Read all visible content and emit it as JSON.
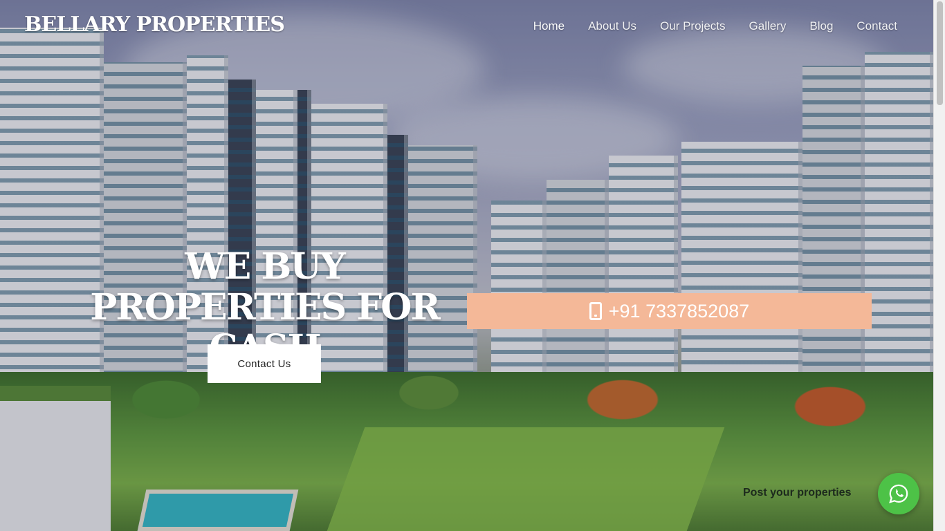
{
  "header": {
    "brand": "BELLARY PROPERTIES",
    "nav": [
      {
        "label": "Home",
        "active": true
      },
      {
        "label": "About Us",
        "active": false
      },
      {
        "label": "Our Projects",
        "active": false
      },
      {
        "label": "Gallery",
        "active": false
      },
      {
        "label": "Blog",
        "active": false
      },
      {
        "label": "Contact",
        "active": false
      }
    ]
  },
  "hero": {
    "headline": "WE BUY PROPERTIES FOR CASH",
    "cta_label": "Contact Us",
    "phone_icon": "mobile-phone-icon",
    "phone": "+91 7337852087",
    "phone_bar_color": "#f4b898"
  },
  "floating": {
    "post_label": "Post your properties",
    "whatsapp_icon": "whatsapp-icon",
    "whatsapp_color": "#4dc247"
  }
}
